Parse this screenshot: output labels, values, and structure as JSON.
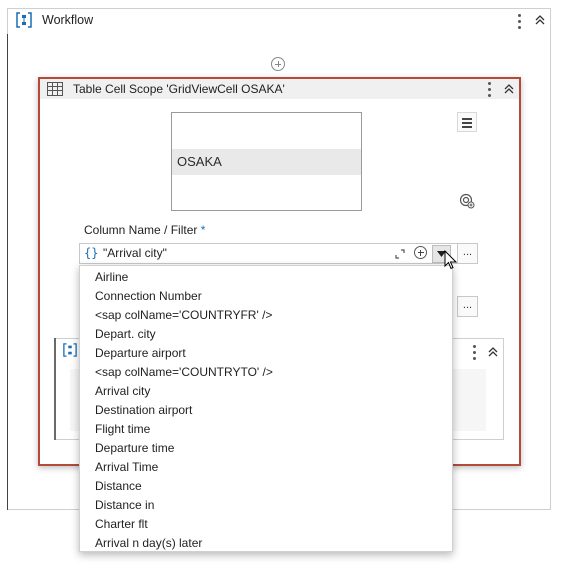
{
  "workflow": {
    "title": "Workflow",
    "icon": "sequence-icon"
  },
  "scope": {
    "title": "Table Cell Scope 'GridViewCell  OSAKA'",
    "icon": "table-icon",
    "preview_text": "OSAKA"
  },
  "filter": {
    "label": "Column Name / Filter",
    "required_mark": "*",
    "brace": "{}",
    "value": "\"Arrival city\"",
    "more_label": "..."
  },
  "dropdown": {
    "options": [
      "Airline",
      "Connection Number",
      "<sap colName='COUNTRYFR' />",
      "Depart. city",
      "Departure airport",
      "<sap colName='COUNTRYTO' />",
      "Arrival city",
      "Destination airport",
      "Flight time",
      "Departure time",
      "Arrival Time",
      "Distance",
      "Distance in",
      "Charter flt",
      "Arrival n day(s) later"
    ]
  },
  "second_field": {
    "more_label": "..."
  },
  "colors": {
    "selected_border": "#b34a3a",
    "accent_blue": "#1a6fb5"
  }
}
